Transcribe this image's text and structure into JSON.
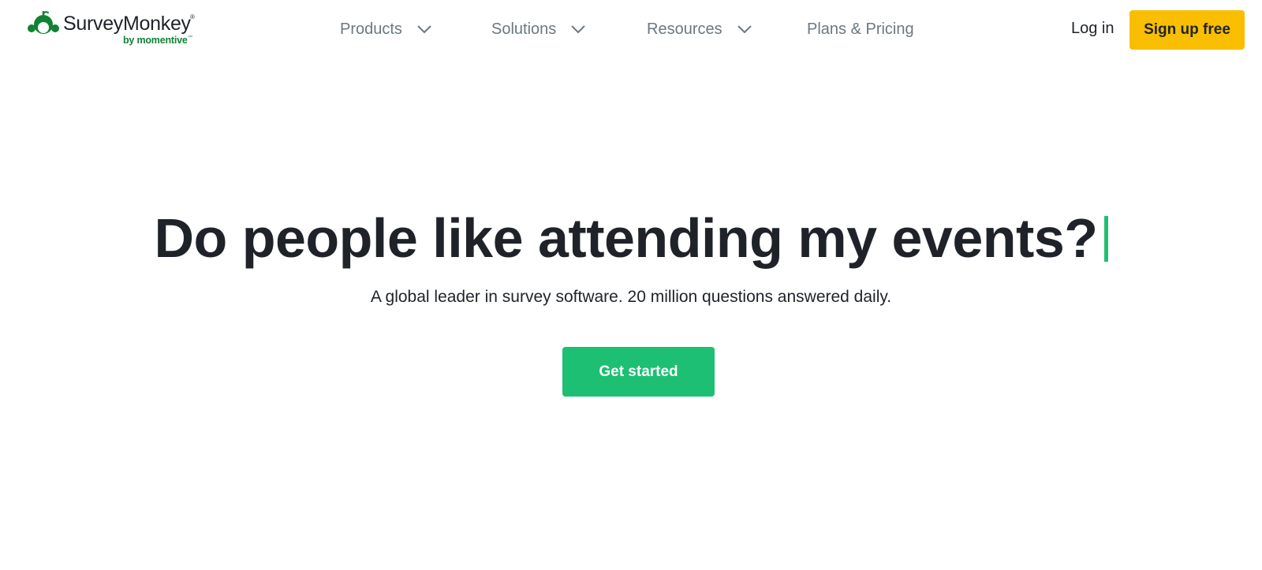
{
  "brand": {
    "name": "SurveyMonkey",
    "registered_mark": "®",
    "tagline": "by momentive",
    "tagline_mark": "™",
    "logo_icon": "monkey-logo-icon",
    "brand_color": "#118233"
  },
  "nav": {
    "items": [
      {
        "label": "Products",
        "icon": "chevron-down-icon"
      },
      {
        "label": "Solutions",
        "icon": "chevron-down-icon"
      },
      {
        "label": "Resources",
        "icon": "chevron-down-icon"
      },
      {
        "label": "Plans & Pricing"
      }
    ],
    "login_label": "Log in",
    "signup_label": "Sign up free",
    "signup_color": "#f9be00"
  },
  "hero": {
    "title": "Do people like attending my events?",
    "subtitle": "A global leader in survey software. 20 million questions answered daily.",
    "cta_label": "Get started",
    "cta_color": "#1dbf73",
    "cursor_color": "#1dbf73"
  }
}
